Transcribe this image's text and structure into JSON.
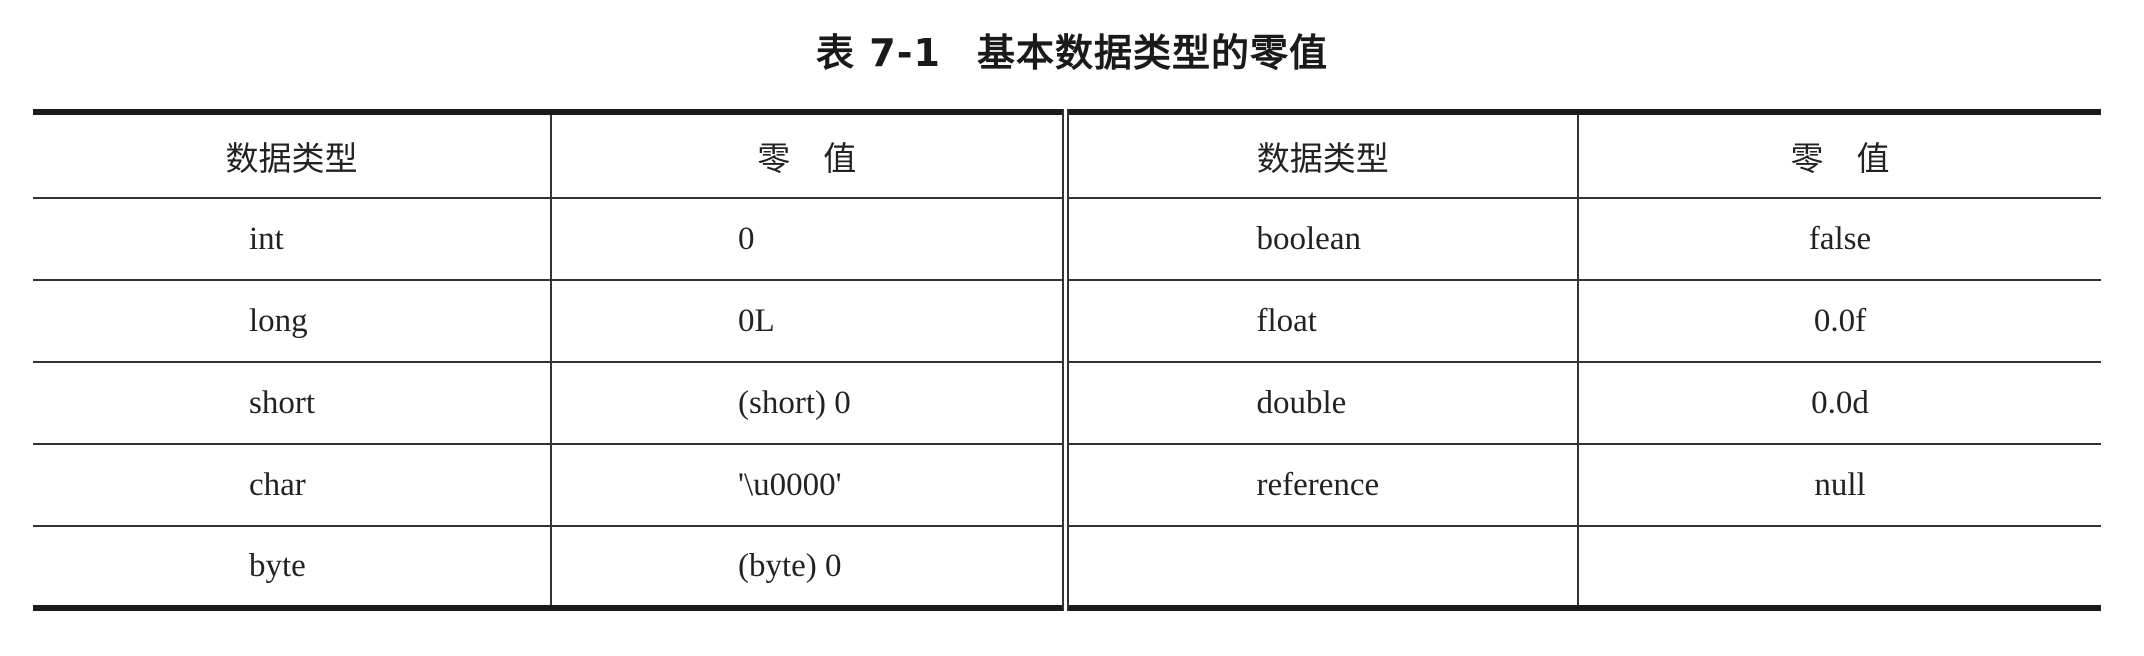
{
  "caption": {
    "number": "表 7-1",
    "title": "基本数据类型的零值"
  },
  "table": {
    "headers": [
      "数据类型",
      "零　值",
      "数据类型",
      "零　值"
    ],
    "rows": [
      [
        "int",
        "0",
        "boolean",
        "false"
      ],
      [
        "long",
        "0L",
        "float",
        "0.0f"
      ],
      [
        "short",
        "(short) 0",
        "double",
        "0.0d"
      ],
      [
        "char",
        "'\\u0000'",
        "reference",
        "null"
      ],
      [
        "byte",
        "(byte) 0",
        "",
        ""
      ]
    ]
  }
}
